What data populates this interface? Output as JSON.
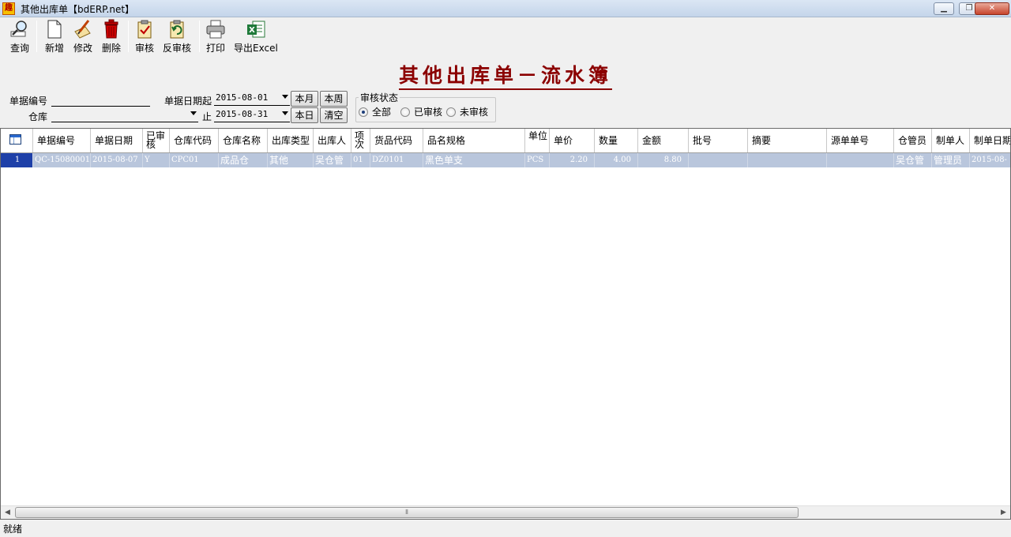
{
  "window": {
    "title": "其他出库单【bdERP.net】",
    "app_icon": "app-logo-icon"
  },
  "toolbar": {
    "query": "查询",
    "add": "新增",
    "edit": "修改",
    "delete": "删除",
    "audit": "审核",
    "unaudit": "反审核",
    "print": "打印",
    "export": "导出Excel"
  },
  "report_title": "其他出库单－流水簿",
  "filters": {
    "doc_no_label": "单据编号",
    "doc_no_value": "",
    "warehouse_label": "仓库",
    "warehouse_value": "",
    "date_from_label": "单据日期起",
    "date_from": "2015-08-01",
    "date_to_label": "止",
    "date_to": "2015-08-31",
    "this_month": "本月",
    "this_week": "本周",
    "today": "本日",
    "clear": "清空",
    "audit_group": "审核状态",
    "audit_options": [
      "全部",
      "已审核",
      "未审核"
    ],
    "audit_selected": "全部"
  },
  "grid": {
    "columns": [
      "单据编号",
      "单据日期",
      "已审核",
      "仓库代码",
      "仓库名称",
      "出库类型",
      "出库人",
      "项次",
      "货品代码",
      "品名规格",
      "单位",
      "单价",
      "数量",
      "金额",
      "批号",
      "摘要",
      "源单单号",
      "仓管员",
      "制单人",
      "制单日期"
    ],
    "rows": [
      {
        "idx": "1",
        "doc_no": "QC-15080001",
        "date": "2015-08-07",
        "audited": "Y",
        "wh_code": "CPC01",
        "wh_name": "成品仓",
        "out_type": "其他",
        "out_person": "吴仓管",
        "line": "01",
        "item_code": "DZ0101",
        "item_name": "黑色单支",
        "unit": "PCS",
        "price": "2.20",
        "qty": "4.00",
        "amount": "8.80",
        "batch": "",
        "memo": "",
        "src_no": "",
        "keeper": "吴仓管",
        "maker": "管理员",
        "make_date": "2015-08-"
      }
    ]
  },
  "status": {
    "text": "就绪"
  }
}
